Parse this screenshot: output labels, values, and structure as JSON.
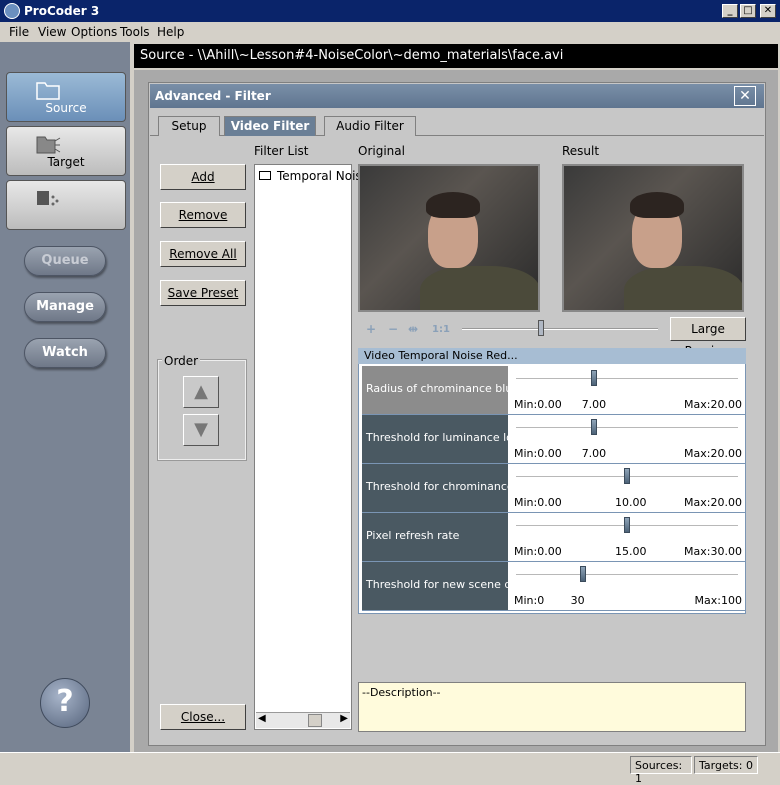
{
  "window": {
    "title": "ProCoder 3"
  },
  "menu": [
    "File",
    "View",
    "Options",
    "Tools",
    "Help"
  ],
  "source_bar": "Source - \\\\Ahill\\~Lesson#4-NoiseColor\\~demo_materials\\face.avi",
  "nav": {
    "source": "Source",
    "target": "Target",
    "queue": "Queue",
    "manage": "Manage",
    "watch": "Watch",
    "help": "?"
  },
  "dialog": {
    "title": "Advanced - Filter",
    "close": "✕",
    "tabs": [
      "Setup",
      "Video Filter",
      "Audio Filter"
    ],
    "buttons": {
      "add": "Add",
      "remove": "Remove",
      "remove_all": "Remove All",
      "save_preset": "Save Preset",
      "close": "Close..."
    },
    "order_label": "Order",
    "filter_list_label": "Filter List",
    "filter_items": [
      "Temporal Noise"
    ],
    "original_label": "Original",
    "result_label": "Result",
    "large_preview": "Large Preview",
    "zoom_icons": {
      "plus": "+",
      "minus": "−",
      "fit": "⇹",
      "one": "1:1"
    },
    "params_header": "Video Temporal Noise Red...",
    "params": [
      {
        "label": "Radius of chrominance blur",
        "min": "Min:0.00",
        "value": "7.00",
        "max": "Max:20.00",
        "fraction": 0.35,
        "selected": true
      },
      {
        "label": "Threshold for luminance loc...",
        "min": "Min:0.00",
        "value": "7.00",
        "max": "Max:20.00",
        "fraction": 0.35,
        "selected": false
      },
      {
        "label": "Threshold for chrominance l...",
        "min": "Min:0.00",
        "value": "10.00",
        "max": "Max:20.00",
        "fraction": 0.5,
        "selected": false
      },
      {
        "label": "Pixel refresh rate",
        "min": "Min:0.00",
        "value": "15.00",
        "max": "Max:30.00",
        "fraction": 0.5,
        "selected": false
      },
      {
        "label": "Threshold for new scene de...",
        "min": "Min:0",
        "value": "30",
        "max": "Max:100",
        "fraction": 0.3,
        "selected": false
      }
    ],
    "description": "--Description--"
  },
  "status": {
    "sources": "Sources: 1",
    "targets": "Targets: 0"
  }
}
